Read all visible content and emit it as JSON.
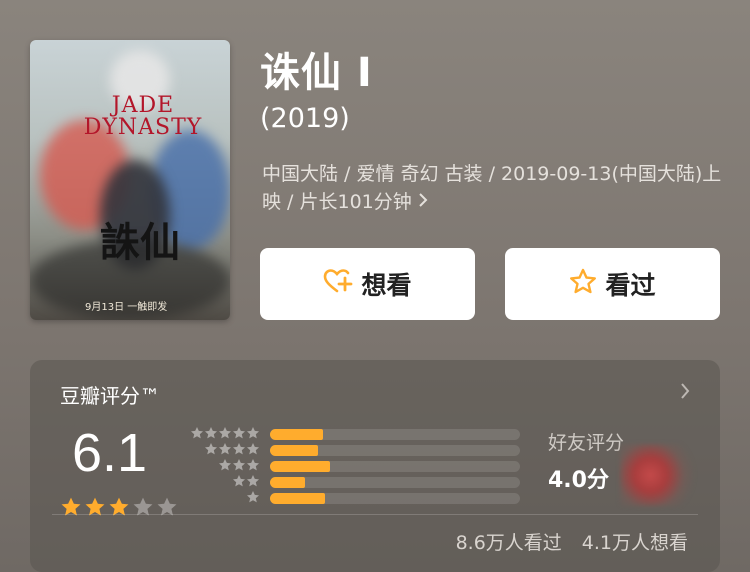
{
  "movie": {
    "poster_title_en": "JADE DYNASTY",
    "poster_title_cn": "誅仙",
    "poster_date": "9月13日 一触即发",
    "title": "诛仙 I",
    "year": "(2019)",
    "meta": "中国大陆 / 爱情 奇幻 古装 / 2019-09-13(中国大陆)上映 / 片长101分钟",
    "meta_more_icon": "chevron-right-icon"
  },
  "actions": {
    "want_label": "想看",
    "want_icon": "heart-plus-icon",
    "seen_label": "看过",
    "seen_icon": "star-outline-icon"
  },
  "rating": {
    "header": "豆瓣评分™",
    "score": "6.1",
    "stars_filled": 3,
    "stars_total": 5,
    "distribution": [
      {
        "stars": 5,
        "fraction": 0.21
      },
      {
        "stars": 4,
        "fraction": 0.19
      },
      {
        "stars": 3,
        "fraction": 0.24
      },
      {
        "stars": 2,
        "fraction": 0.14
      },
      {
        "stars": 1,
        "fraction": 0.22
      }
    ],
    "friend_label": "好友评分",
    "friend_score": "4.0分",
    "watched": "8.6万人看过",
    "wanted": "4.1万人想看"
  },
  "colors": {
    "accent": "#ffac2d",
    "background": "#7d7670",
    "card": "#5a5550"
  }
}
